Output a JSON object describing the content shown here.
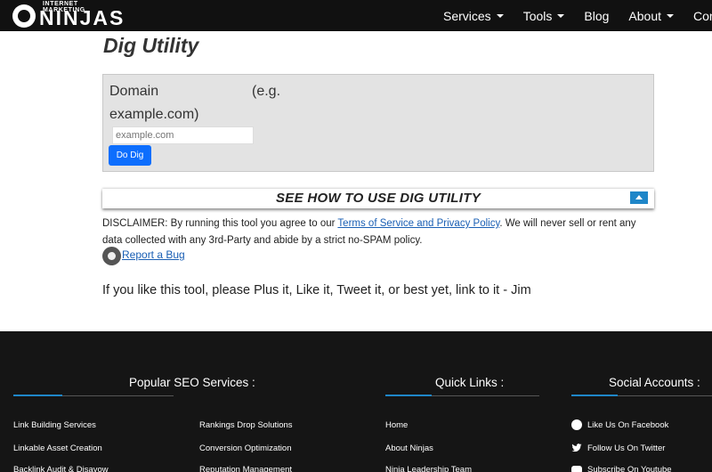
{
  "header": {
    "logo_top": "INTERNET MARKETING",
    "logo_main": "NINJAS",
    "nav": [
      {
        "label": "Services",
        "dropdown": true
      },
      {
        "label": "Tools",
        "dropdown": true
      },
      {
        "label": "Blog",
        "dropdown": false
      },
      {
        "label": "About",
        "dropdown": true
      },
      {
        "label": "Con",
        "dropdown": false
      }
    ]
  },
  "main": {
    "title": "Dig Utility",
    "form": {
      "domain_label": "Domain",
      "hint_part1": "(e.g.",
      "hint_part2": "example.com)",
      "input_placeholder": "example.com",
      "input_value": "",
      "button_label": "Do Dig"
    },
    "howto_title": "SEE HOW TO USE DIG UTILITY",
    "disclaimer": {
      "prefix": "DISCLAIMER: By running this tool you agree to our ",
      "link": "Terms of Service and Privacy Policy",
      "suffix": ". We will never sell or rent any data collected with any 3rd-Party and abide by a strict no-SPAM policy."
    },
    "report_bug": "Report a Bug",
    "like_text": "If you like this tool, please Plus it, Like it, Tweet it, or best yet, link to it - Jim"
  },
  "footer": {
    "popular_heading": "Popular SEO Services :",
    "popular_col1": [
      "Link Building Services",
      "Linkable Asset Creation",
      "Backlink Audit & Disavow"
    ],
    "popular_col2": [
      "Rankings Drop Solutions",
      "Conversion Optimization",
      "Reputation Management"
    ],
    "quick_heading": "Quick Links :",
    "quick_links": [
      "Home",
      "About Ninjas",
      "Ninja Leadership Team"
    ],
    "social_heading": "Social Accounts :",
    "social_links": [
      {
        "icon": "facebook-icon",
        "label": "Like Us On Facebook"
      },
      {
        "icon": "twitter-icon",
        "label": "Follow Us On Twitter"
      },
      {
        "icon": "youtube-icon",
        "label": "Subscribe On Youtube"
      }
    ]
  },
  "colors": {
    "nav_bg": "#111111",
    "accent": "#1f86c8",
    "button": "#0d6efd",
    "footer_bg": "#151515"
  }
}
